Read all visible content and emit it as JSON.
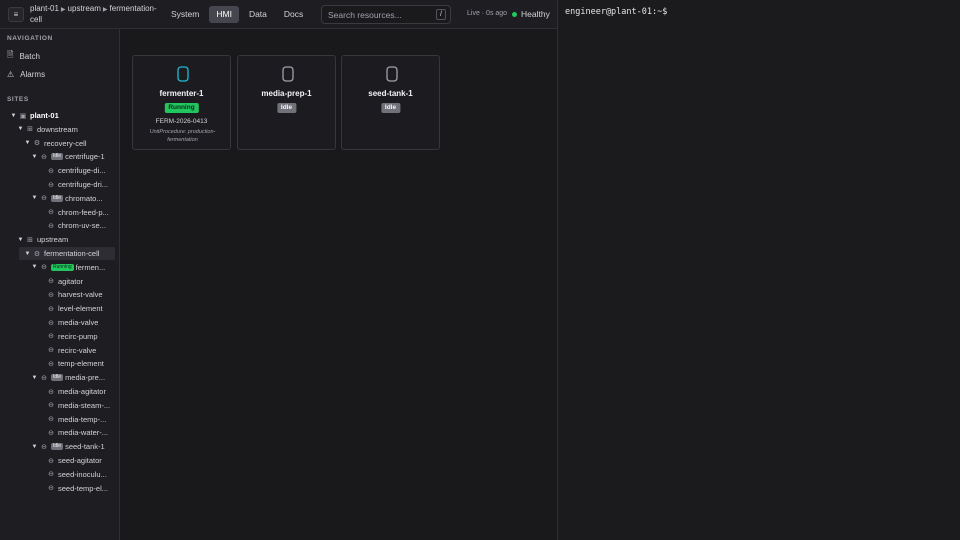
{
  "header": {
    "menu_icon": "hamburger-icon",
    "breadcrumb": [
      "plant-01",
      "upstream",
      "fermentation-cell"
    ],
    "tabs": [
      {
        "label": "System",
        "active": false
      },
      {
        "label": "HMI",
        "active": true
      },
      {
        "label": "Data",
        "active": false
      },
      {
        "label": "Docs",
        "active": false
      }
    ],
    "search": {
      "placeholder": "Search resources...",
      "shortcut": "/"
    },
    "live_text": "Live · 0s ago",
    "health_text": "Healthy",
    "health_color": "#22c55e"
  },
  "sidebar": {
    "navigation_title": "NAVIGATION",
    "nav_items": [
      {
        "label": "Batch",
        "icon": "document-icon"
      },
      {
        "label": "Alarms",
        "icon": "warning-icon"
      }
    ],
    "sites_title": "SITES",
    "tree": [
      {
        "label": "plant-01",
        "level": 0,
        "kind": "site",
        "caret": true
      },
      {
        "label": "downstream",
        "level": 1,
        "kind": "area",
        "caret": true
      },
      {
        "label": "recovery-cell",
        "level": 2,
        "kind": "cell",
        "caret": true
      },
      {
        "label": "centrifuge-1",
        "level": 3,
        "kind": "unit",
        "caret": true,
        "badge": "Idle"
      },
      {
        "label": "centrifuge-di...",
        "level": 4,
        "kind": "module"
      },
      {
        "label": "centrifuge-dri...",
        "level": 4,
        "kind": "module"
      },
      {
        "label": "chromato...",
        "level": 3,
        "kind": "unit",
        "caret": true,
        "badge": "Idle"
      },
      {
        "label": "chrom-feed-p...",
        "level": 4,
        "kind": "module"
      },
      {
        "label": "chrom-uv-se...",
        "level": 4,
        "kind": "module"
      },
      {
        "label": "upstream",
        "level": 1,
        "kind": "area",
        "caret": true
      },
      {
        "label": "fermentation-cell",
        "level": 2,
        "kind": "cell",
        "caret": true,
        "selected": true
      },
      {
        "label": "fermen...",
        "level": 3,
        "kind": "unit",
        "caret": true,
        "badge": "Running"
      },
      {
        "label": "agitator",
        "level": 4,
        "kind": "module"
      },
      {
        "label": "harvest-valve",
        "level": 4,
        "kind": "module"
      },
      {
        "label": "level-element",
        "level": 4,
        "kind": "module"
      },
      {
        "label": "media-valve",
        "level": 4,
        "kind": "module"
      },
      {
        "label": "recirc-pump",
        "level": 4,
        "kind": "module"
      },
      {
        "label": "recirc-valve",
        "level": 4,
        "kind": "module"
      },
      {
        "label": "temp-element",
        "level": 4,
        "kind": "module"
      },
      {
        "label": "media-pre...",
        "level": 3,
        "kind": "unit",
        "caret": true,
        "badge": "Idle"
      },
      {
        "label": "media-agitator",
        "level": 4,
        "kind": "module"
      },
      {
        "label": "media-steam-...",
        "level": 4,
        "kind": "module"
      },
      {
        "label": "media-temp-...",
        "level": 4,
        "kind": "module"
      },
      {
        "label": "media-water-...",
        "level": 4,
        "kind": "module"
      },
      {
        "label": "seed-tank-1",
        "level": 3,
        "kind": "unit",
        "caret": true,
        "badge": "Idle"
      },
      {
        "label": "seed-agitator",
        "level": 4,
        "kind": "module"
      },
      {
        "label": "seed-inoculu...",
        "level": 4,
        "kind": "module"
      },
      {
        "label": "seed-temp-el...",
        "level": 4,
        "kind": "module"
      }
    ]
  },
  "cards": [
    {
      "name": "fermenter-1",
      "status": "Running",
      "batch": "FERM-2026-0413",
      "procedure": "UnitProcedure: production-fermentation",
      "tank_color": "#22b8cf"
    },
    {
      "name": "media-prep-1",
      "status": "Idle",
      "tank_color": "#a1a1aa"
    },
    {
      "name": "seed-tank-1",
      "status": "Idle",
      "tank_color": "#a1a1aa"
    }
  ],
  "terminal": {
    "prompt": "engineer@plant-01:~$"
  }
}
